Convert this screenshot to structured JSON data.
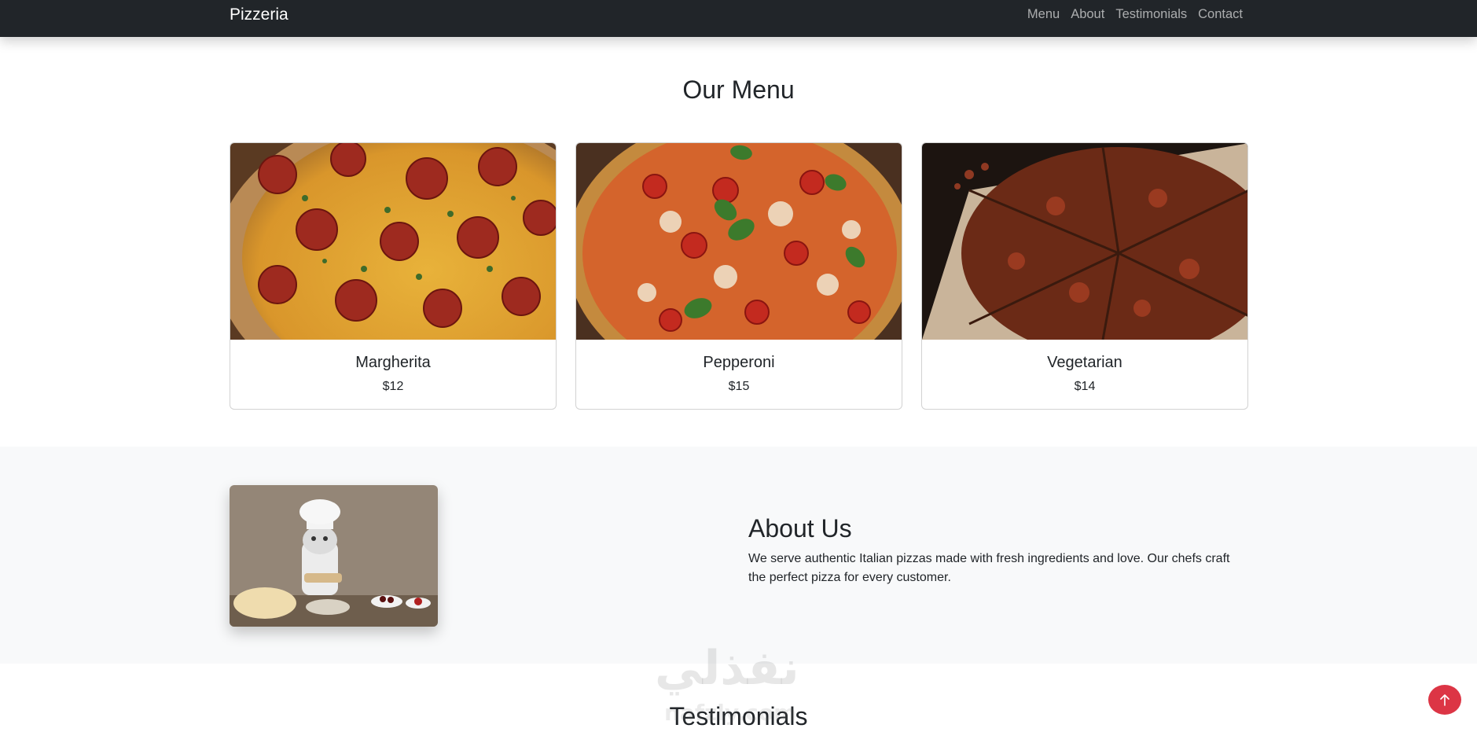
{
  "navbar": {
    "brand": "Pizzeria",
    "links": [
      "Menu",
      "About",
      "Testimonials",
      "Contact"
    ]
  },
  "menu": {
    "title": "Our Menu",
    "items": [
      {
        "name": "Margherita",
        "price": "$12",
        "image": "pepperoni-pizza-photo"
      },
      {
        "name": "Pepperoni",
        "price": "$15",
        "image": "basil-tomato-pizza-photo"
      },
      {
        "name": "Vegetarian",
        "price": "$14",
        "image": "sliced-pizza-board-photo"
      }
    ]
  },
  "about": {
    "title": "About Us",
    "text": "We serve authentic Italian pizzas made with fresh ingredients and love. Our chefs craft the perfect pizza for every customer.",
    "image": "chef-cat-photo"
  },
  "testimonials": {
    "title": "Testimonials"
  },
  "watermark": {
    "text": "نفذلي",
    "sub": "nafzly.com"
  },
  "colors": {
    "navbar_bg": "#212529",
    "section_bg": "#f8f9fa",
    "back_to_top": "#dc3545"
  },
  "icons": {
    "back_to_top": "arrow-up-icon"
  }
}
